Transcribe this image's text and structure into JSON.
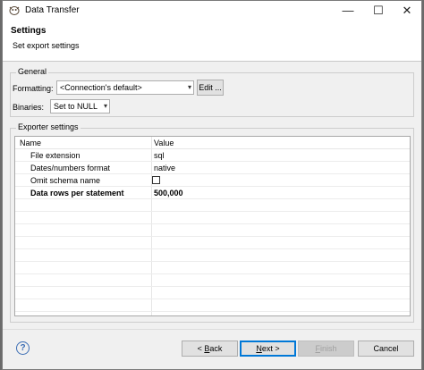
{
  "window": {
    "title": "Data Transfer",
    "controls": {
      "minimize": "—",
      "maximize": "☐",
      "close": "✕"
    }
  },
  "header": {
    "title": "Settings",
    "subtitle": "Set export settings"
  },
  "general": {
    "legend": "General",
    "formatting_label": "Formatting:",
    "formatting_value": "<Connection's default>",
    "edit_button": "Edit ...",
    "binaries_label": "Binaries:",
    "binaries_value": "Set to NULL"
  },
  "exporter": {
    "legend": "Exporter settings",
    "columns": [
      "Name",
      "Value"
    ],
    "rows": [
      {
        "name": "File extension",
        "value": "sql",
        "bold": false
      },
      {
        "name": "Dates/numbers format",
        "value": "native",
        "bold": false
      },
      {
        "name": "Omit schema name",
        "value": "",
        "checkbox": true,
        "checked": false,
        "bold": false
      },
      {
        "name": "Data rows per statement",
        "value": "500,000",
        "bold": true
      }
    ]
  },
  "footer": {
    "help": "?",
    "back": {
      "prefix": "< ",
      "mnemonic": "B",
      "rest": "ack"
    },
    "next": {
      "mnemonic": "N",
      "rest": "ext >"
    },
    "finish": {
      "mnemonic": "F",
      "rest": "inish"
    },
    "cancel": "Cancel"
  },
  "colors": {
    "accent": "#0078d7",
    "window_bg": "#f0f0f0",
    "panel_bg": "#ffffff"
  }
}
